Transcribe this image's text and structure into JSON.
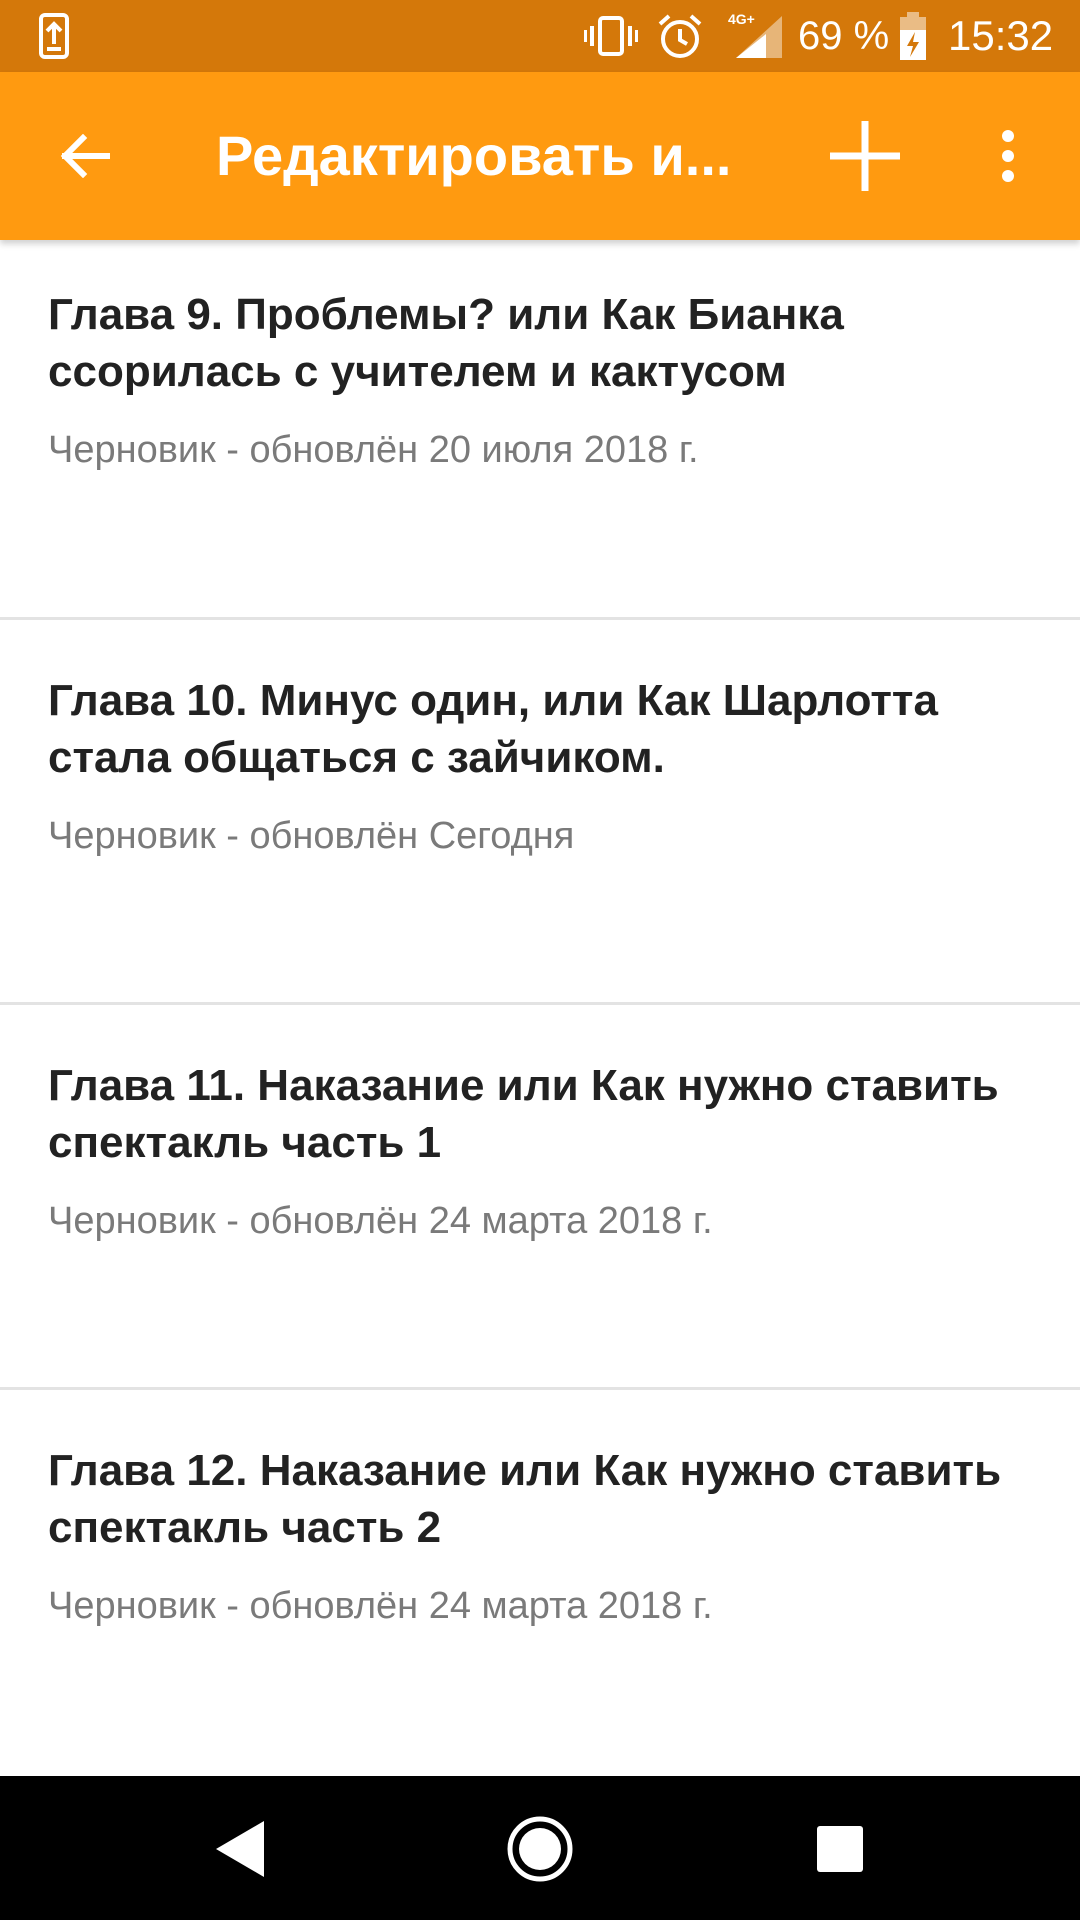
{
  "status_bar": {
    "battery_percent": "69 %",
    "clock": "15:32",
    "network": "4G+",
    "icons": [
      "screenshot-share-icon",
      "vibrate-icon",
      "alarm-icon",
      "signal-icon",
      "battery-charging-icon"
    ]
  },
  "app_bar": {
    "title": "Редактировать и...",
    "back_icon": "arrow-back-icon",
    "add_icon": "plus-icon",
    "more_icon": "more-vert-icon"
  },
  "parts": [
    {
      "title": "Глава 9. Проблемы? или Как Бианка ссорилась с учителем и кактусом",
      "status": "Черновик - обновлён 20 июля 2018 г."
    },
    {
      "title": "Глава 10. Минус один, или Как Шарлотта стала общаться с зайчиком.",
      "status": "Черновик - обновлён Сегодня"
    },
    {
      "title": "Глава 11. Наказание или Как нужно ставить спектакль часть 1",
      "status": "Черновик - обновлён 24 марта 2018 г."
    },
    {
      "title": "Глава 12. Наказание или Как нужно ставить спектакль часть 2",
      "status": "Черновик - обновлён 24 марта 2018 г."
    }
  ],
  "nav_bar": {
    "icons": [
      "nav-back-icon",
      "nav-home-icon",
      "nav-recents-icon"
    ]
  },
  "colors": {
    "status_bar": "#D4780A",
    "app_bar": "#FF9A10",
    "title_text": "#222222",
    "status_text": "#7a7a7a",
    "divider": "#E3E3E3",
    "nav_bar": "#000000"
  }
}
